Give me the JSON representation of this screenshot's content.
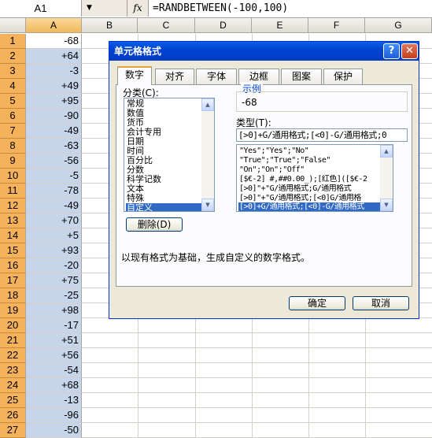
{
  "formula_bar": {
    "name_box": "A1",
    "dropdown_glyph": "▼",
    "fx_label": "fx",
    "formula": "=RANDBETWEEN(-100,100)"
  },
  "columns": [
    "A",
    "B",
    "C",
    "D",
    "E",
    "F",
    "G"
  ],
  "rows": [
    {
      "num": "1",
      "value": "-68"
    },
    {
      "num": "2",
      "value": "+64"
    },
    {
      "num": "3",
      "value": "-3"
    },
    {
      "num": "4",
      "value": "+49"
    },
    {
      "num": "5",
      "value": "+95"
    },
    {
      "num": "6",
      "value": "-90"
    },
    {
      "num": "7",
      "value": "-49"
    },
    {
      "num": "8",
      "value": "-63"
    },
    {
      "num": "9",
      "value": "-56"
    },
    {
      "num": "10",
      "value": "-5"
    },
    {
      "num": "11",
      "value": "-78"
    },
    {
      "num": "12",
      "value": "-49"
    },
    {
      "num": "13",
      "value": "+70"
    },
    {
      "num": "14",
      "value": "+5"
    },
    {
      "num": "15",
      "value": "+93"
    },
    {
      "num": "16",
      "value": "-20"
    },
    {
      "num": "17",
      "value": "+75"
    },
    {
      "num": "18",
      "value": "-25"
    },
    {
      "num": "19",
      "value": "+98"
    },
    {
      "num": "20",
      "value": "-17"
    },
    {
      "num": "21",
      "value": "+51"
    },
    {
      "num": "22",
      "value": "+56"
    },
    {
      "num": "23",
      "value": "-54"
    },
    {
      "num": "24",
      "value": "+68"
    },
    {
      "num": "25",
      "value": "-13"
    },
    {
      "num": "26",
      "value": "-96"
    },
    {
      "num": "27",
      "value": "-50"
    }
  ],
  "dialog": {
    "title": "单元格格式",
    "help_glyph": "?",
    "close_glyph": "✕",
    "tabs": [
      "数字",
      "对齐",
      "字体",
      "边框",
      "图案",
      "保护"
    ],
    "category_label": "分类(C):",
    "categories": [
      "常规",
      "数值",
      "货币",
      "会计专用",
      "日期",
      "时间",
      "百分比",
      "分数",
      "科学记数",
      "文本",
      "特殊",
      "自定义"
    ],
    "selected_category": "自定义",
    "sample_label": "示例",
    "sample_value": "-68",
    "type_label": "类型(T):",
    "type_input": "[>0]+G/通用格式;[<0]-G/通用格式;0",
    "type_items": [
      "\"Yes\";\"Yes\";\"No\"",
      "\"True\";\"True\";\"False\"",
      "\"On\";\"On\";\"Off\"",
      "[$€-2] #,##0.00_);[红色]([$€-2",
      "[>0]\"+\"G/通用格式;G/通用格式",
      "[>0]\"+\"G/通用格式;[<0]G/通用格",
      "[>0]+G/通用格式;[<0]-G/通用格式"
    ],
    "delete_button": "删除(D)",
    "description": "以现有格式为基础，生成自定义的数字格式。",
    "ok_button": "确定",
    "cancel_button": "取消"
  },
  "colors": {
    "selection_fill": "#c6d5ea",
    "row_header_selected": "#f6b25a",
    "dialog_title": "#0043d0",
    "list_highlight": "#316ac5"
  }
}
